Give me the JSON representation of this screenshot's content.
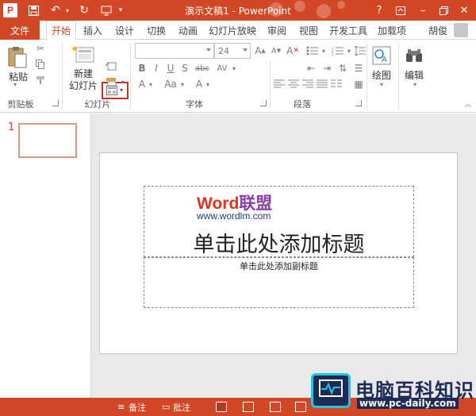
{
  "window": {
    "title": "演示文稿1 - PowerPoint",
    "app_logo": "P",
    "help": "?",
    "minimize": "–",
    "close": "✕"
  },
  "colors": {
    "accent": "#d24726",
    "slide_bg": "#ffffff",
    "canvas_bg": "#e9e9e9",
    "selection_highlight": "#c8302a"
  },
  "tabs": {
    "file": "文件",
    "items": [
      "开始",
      "插入",
      "设计",
      "切换",
      "动画",
      "幻灯片放映",
      "审阅",
      "视图",
      "开发工具",
      "加载项"
    ],
    "active": "开始",
    "user": "胡俊"
  },
  "ribbon": {
    "clipboard": {
      "paste_label": "粘贴",
      "group_label": "剪贴板"
    },
    "slides": {
      "new_slide_label_1": "新建",
      "new_slide_label_2": "幻灯片",
      "group_label": "幻灯片",
      "layout_icon": "slide-layout-icon"
    },
    "font": {
      "font_name": "",
      "font_size": "24",
      "group_label": "字体",
      "bold": "B",
      "italic": "I",
      "underline": "U",
      "shadow": "S",
      "strike": "abc",
      "spacing": "AV",
      "case": "Aa",
      "grow": "A",
      "shrink": "A",
      "clear": "A",
      "color": "A"
    },
    "paragraph": {
      "group_label": "段落"
    },
    "drawing": {
      "label": "绘图"
    },
    "editing": {
      "label": "编辑"
    }
  },
  "thumbnails": [
    {
      "number": "1"
    }
  ],
  "slide": {
    "title_placeholder": "单击此处添加标题",
    "subtitle_placeholder": "单击此处添加副标题",
    "watermark_word": "Word",
    "watermark_lianmeng": "联盟",
    "watermark_url": "www.wordlm.com"
  },
  "statusbar": {
    "notes": "备注",
    "comments": "批注"
  },
  "corner_watermark": {
    "title": "电脑百科知识",
    "url": "www.pc-daily.com"
  }
}
